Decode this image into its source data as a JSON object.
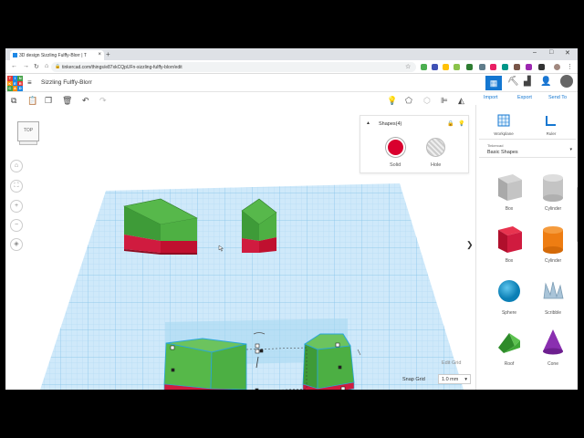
{
  "browser": {
    "tab_title": "3D design Sizzling Fulffy-Blorr | T",
    "tab_close": "×",
    "new_tab": "+",
    "url": "tinkercad.com/things/e87xkCQpUFn-sizzling-fulffy-blorr/edit",
    "nav": {
      "back": "←",
      "forward": "→",
      "reload": "↻",
      "home": "⌂",
      "lock": "🔒",
      "star": "☆"
    },
    "window_controls": {
      "minimize": "–",
      "maximize": "□",
      "close": "✕"
    }
  },
  "header": {
    "logo_letters": [
      "T",
      "I",
      "N",
      "K",
      "E",
      "R",
      "C",
      "A",
      "D"
    ],
    "design_title": "Sizzling Fulffy-Blorr",
    "menu_icon": "≡"
  },
  "toolbar": {
    "copy": "⧉",
    "paste": "📋",
    "duplicate": "❐",
    "delete": "🗑",
    "undo": "↶",
    "redo": "↷"
  },
  "right_tabs": {
    "import": "Import",
    "export": "Export",
    "send_to": "Send To"
  },
  "workspace": {
    "viewcube_label": "TOP",
    "shapes_panel": {
      "title": "Shapes(4)",
      "solid_label": "Solid",
      "hole_label": "Hole",
      "solid_color": "#d9002e"
    },
    "expand_arrow": "❯",
    "edit_grid": "Edit Grid",
    "snap_grid_label": "Snap Grid",
    "snap_grid_value": "1.0 mm",
    "snap_grid_caret": "▾"
  },
  "right_panel": {
    "workplane_label": "Workplane",
    "ruler_label": "Ruler",
    "library_small": "Tinkercad",
    "library_name": "Basic Shapes",
    "library_caret": "▾",
    "shapes": [
      {
        "label": "Box",
        "icon": "box-gray-icon"
      },
      {
        "label": "Cylinder",
        "icon": "cylinder-gray-icon"
      },
      {
        "label": "Box",
        "icon": "box-red-icon"
      },
      {
        "label": "Cylinder",
        "icon": "cylinder-orange-icon"
      },
      {
        "label": "Sphere",
        "icon": "sphere-blue-icon"
      },
      {
        "label": "Scribble",
        "icon": "scribble-icon"
      },
      {
        "label": "Roof",
        "icon": "roof-green-icon"
      },
      {
        "label": "Cone",
        "icon": "cone-purple-icon"
      }
    ]
  }
}
